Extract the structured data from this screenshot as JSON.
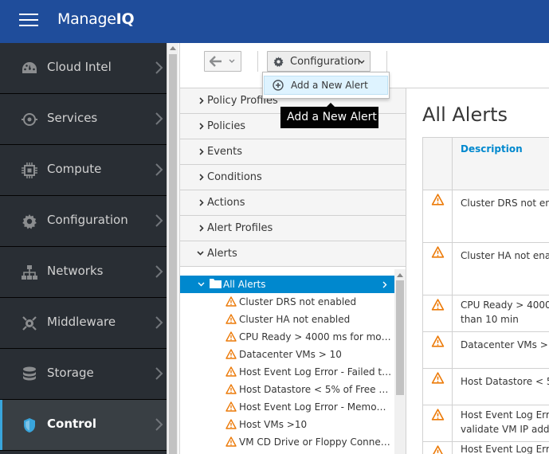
{
  "brand": {
    "name_light": "Manage",
    "name_bold": "IQ"
  },
  "sidebar": {
    "items": [
      {
        "label": "Cloud Intel",
        "icon": "dashboard-icon"
      },
      {
        "label": "Services",
        "icon": "services-icon"
      },
      {
        "label": "Compute",
        "icon": "cpu-icon"
      },
      {
        "label": "Configuration",
        "icon": "gear-icon"
      },
      {
        "label": "Networks",
        "icon": "network-icon"
      },
      {
        "label": "Middleware",
        "icon": "middleware-icon"
      },
      {
        "label": "Storage",
        "icon": "database-icon"
      },
      {
        "label": "Control",
        "icon": "shield-icon"
      }
    ]
  },
  "toolbar": {
    "configuration_label": "Configuration"
  },
  "menu": {
    "add_alert_label": "Add a New Alert",
    "tooltip": "Add a New Alert"
  },
  "accordion": {
    "sections": [
      "Policy Profiles",
      "Policies",
      "Events",
      "Conditions",
      "Actions",
      "Alert Profiles",
      "Alerts"
    ]
  },
  "tree": {
    "root": "All Alerts",
    "items": [
      "Cluster DRS not enabled",
      "Cluster HA not enabled",
      "CPU Ready > 4000 ms for mo…",
      "Datacenter VMs > 10",
      "Host Event Log Error - Failed t…",
      "Host Datastore < 5% of Free …",
      "Host Event Log Error - Memo…",
      "Host VMs >10",
      "VM CD Drive or Floppy Conne…"
    ]
  },
  "main": {
    "title": "All Alerts",
    "column_description": "Description",
    "rows": [
      {
        "line1": "Cluster DRS not ena",
        "line2": ""
      },
      {
        "line1": "Cluster HA not enab",
        "line2": ""
      },
      {
        "line1": "CPU Ready > 4000 m",
        "line2": "than 10 min"
      },
      {
        "line1": "Datacenter VMs > 10",
        "line2": ""
      },
      {
        "line1": "Host Datastore < 5%",
        "line2": ""
      },
      {
        "line1": "Host Event Log Erro",
        "line2": "validate VM IP addre"
      },
      {
        "line1": "Host Event Log Erro",
        "line2": ""
      }
    ]
  },
  "colors": {
    "header": "#1f4d9b",
    "sidebar": "#292e34",
    "accent": "#0088ce",
    "warning": "#ec7a08"
  }
}
